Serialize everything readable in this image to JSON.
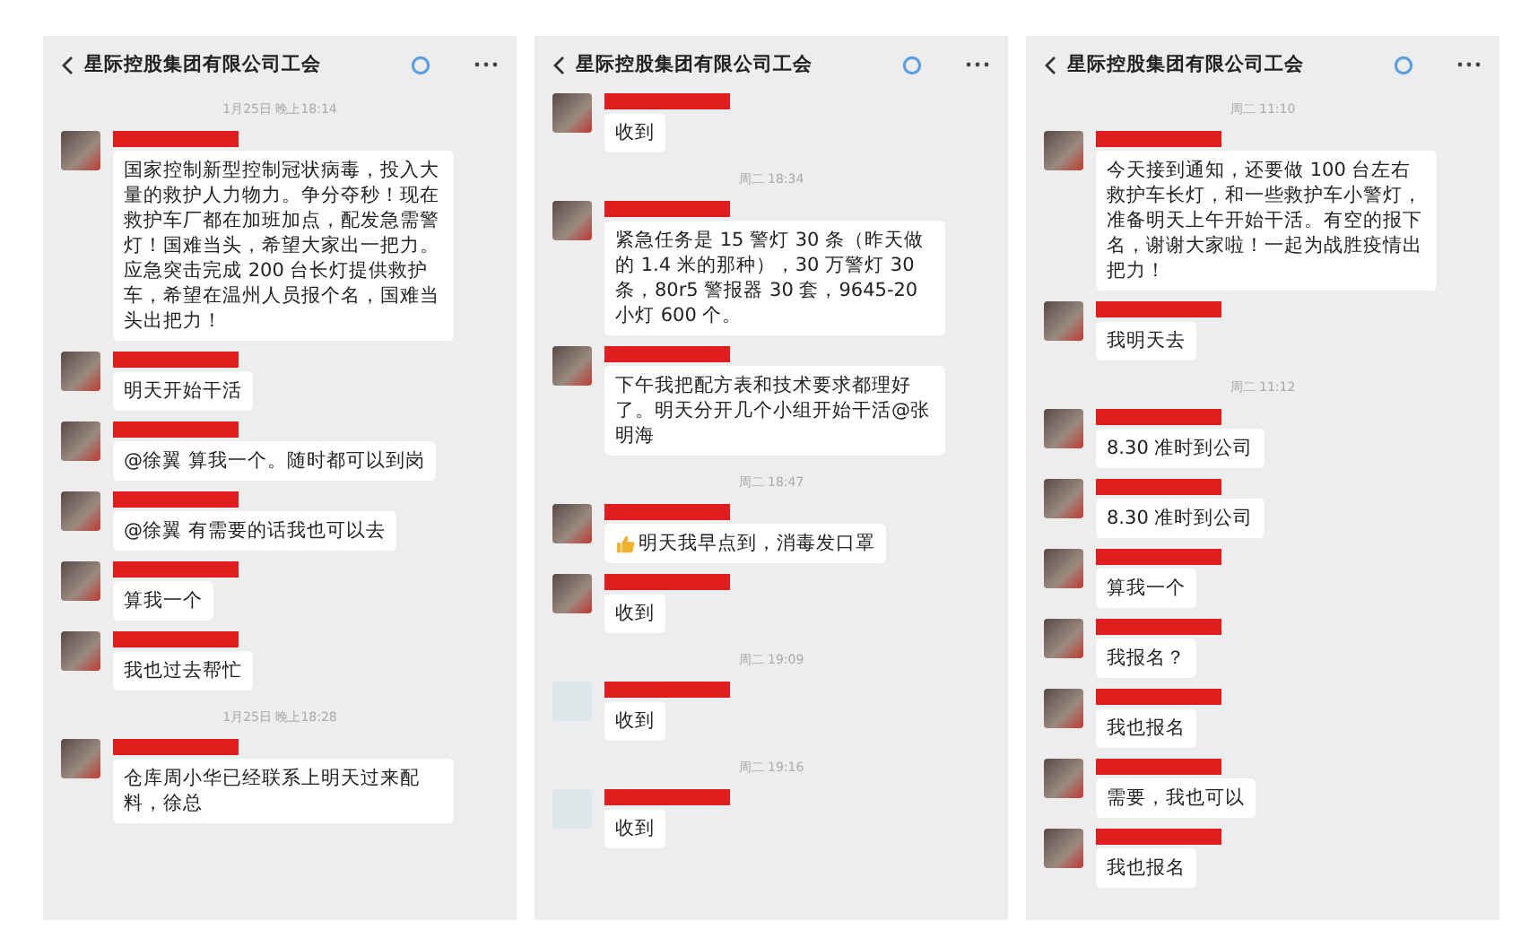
{
  "panels": [
    {
      "header": {
        "title": "星际控股集团有限公司工会"
      },
      "items": [
        {
          "kind": "time",
          "text": "1月25日 晚上18:14"
        },
        {
          "kind": "message",
          "text": "国家控制新型控制冠状病毒，投入大量的救护人力物力。争分夺秒！现在救护车厂都在加班加点，配发急需警灯！国难当头，希望大家出一把力。应急突击完成 200 台长灯提供救护车，希望在温州人员报个名，国难当头出把力！"
        },
        {
          "kind": "message",
          "text": "明天开始干活"
        },
        {
          "kind": "message",
          "text": "@徐翼  算我一个。随时都可以到岗"
        },
        {
          "kind": "message",
          "text": "@徐翼  有需要的话我也可以去"
        },
        {
          "kind": "message",
          "text": "算我一个"
        },
        {
          "kind": "message",
          "text": "我也过去帮忙"
        },
        {
          "kind": "time",
          "text": "1月25日 晚上18:28"
        },
        {
          "kind": "message",
          "text": "仓库周小华已经联系上明天过来配料，徐总"
        }
      ]
    },
    {
      "header": {
        "title": "星际控股集团有限公司工会"
      },
      "items": [
        {
          "kind": "message",
          "text": "收到"
        },
        {
          "kind": "time",
          "text": "周二 18:34"
        },
        {
          "kind": "message",
          "text": "紧急任务是 15 警灯 30 条（昨天做的 1.4 米的那种），30 万警灯 30 条，80r5 警报器 30 套，9645-20 小灯 600 个。"
        },
        {
          "kind": "message",
          "text": "下午我把配方表和技术要求都理好了。明天分开几个小组开始干活@张明海"
        },
        {
          "kind": "time",
          "text": "周二 18:47"
        },
        {
          "kind": "thumbs_message",
          "text": "明天我早点到，消毒发口罩"
        },
        {
          "kind": "message",
          "text": "收到"
        },
        {
          "kind": "time",
          "text": "周二 19:09"
        },
        {
          "kind": "blank_avatar_message",
          "text": "收到"
        },
        {
          "kind": "time",
          "text": "周二 19:16"
        },
        {
          "kind": "blank_avatar_message",
          "text": "收到"
        }
      ]
    },
    {
      "header": {
        "title": "星际控股集团有限公司工会"
      },
      "items": [
        {
          "kind": "time",
          "text": "周二 11:10"
        },
        {
          "kind": "message",
          "text": "今天接到通知，还要做 100 台左右救护车长灯，和一些救护车小警灯，准备明天上午开始干活。有空的报下名，谢谢大家啦！一起为战胜疫情出把力！"
        },
        {
          "kind": "message",
          "text": "我明天去"
        },
        {
          "kind": "time",
          "text": "周二 11:12"
        },
        {
          "kind": "message",
          "text": "8.30 准时到公司"
        },
        {
          "kind": "message",
          "text": "8.30 准时到公司"
        },
        {
          "kind": "message",
          "text": "算我一个"
        },
        {
          "kind": "message",
          "text": "我报名？"
        },
        {
          "kind": "message",
          "text": "我也报名"
        },
        {
          "kind": "message",
          "text": "需要，我也可以"
        },
        {
          "kind": "message",
          "text": "我也报名"
        }
      ]
    }
  ]
}
